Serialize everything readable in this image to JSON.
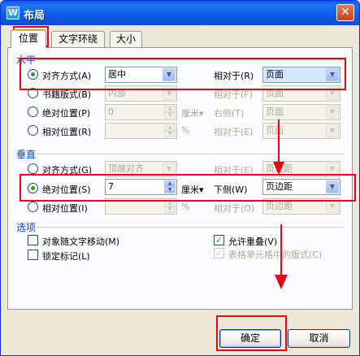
{
  "window": {
    "title": "布局",
    "app_icon": "W"
  },
  "tabs": [
    {
      "label": "位置",
      "active": true
    },
    {
      "label": "文字环绕",
      "active": false
    },
    {
      "label": "大小",
      "active": false
    }
  ],
  "horizontal": {
    "title": "水平",
    "align": {
      "label": "对齐方式(A)",
      "value": "居中",
      "relative_label": "相对于(R)",
      "relative_value": "页面"
    },
    "book": {
      "label": "书籍版式(B)",
      "value": "内部",
      "relative_label": "相对于(F)",
      "relative_value": "页面"
    },
    "absolute": {
      "label": "绝对位置(P)",
      "value": "0",
      "unit": "厘米",
      "side_label": "右侧(T)",
      "side_value": "页面"
    },
    "relative": {
      "label": "相对位置(R)",
      "unit": "%",
      "relative_label": "相对于(E)",
      "relative_value": "页面"
    }
  },
  "vertical": {
    "title": "垂直",
    "align": {
      "label": "对齐方式(G)",
      "value": "顶端对齐",
      "relative_label": "相对于(E)",
      "relative_value": "页边距"
    },
    "absolute": {
      "label": "绝对位置(S)",
      "value": "7",
      "unit": "厘米",
      "side_label": "下侧(W)",
      "side_value": "页边距"
    },
    "relative": {
      "label": "相对位置(I)",
      "unit": "%",
      "relative_label": "相对于(O)",
      "relative_value": "页边距"
    }
  },
  "options": {
    "title": "选项",
    "move_with_text": "对象随文字移动(M)",
    "lock_anchor": "锁定标记(L)",
    "allow_overlap": "允许重叠(V)",
    "table_layout": "表格单元格中的版式(C)"
  },
  "buttons": {
    "ok": "确定",
    "cancel": "取消"
  },
  "icons": {
    "combo_arrow": "▼",
    "spin_up": "▲",
    "spin_down": "▼",
    "close": "✕",
    "check": "✓",
    "unit_arrow": "▾"
  },
  "colors": {
    "annotation_red": "#e8001a",
    "accent_blue": "#0046d5"
  }
}
